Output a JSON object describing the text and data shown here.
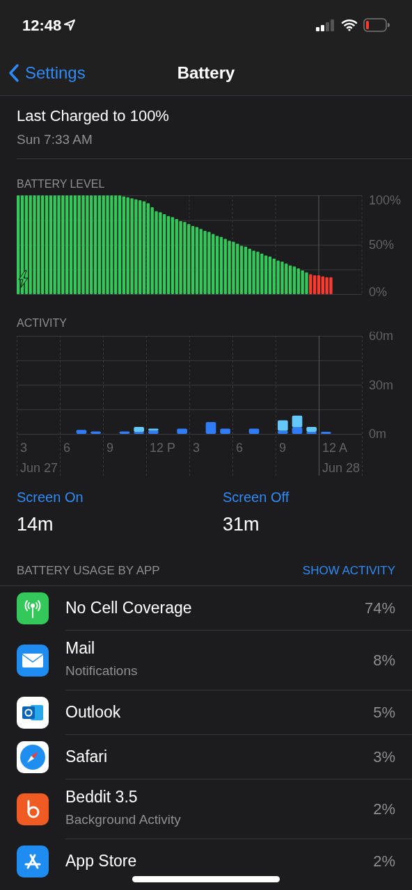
{
  "status_bar": {
    "time": "12:48"
  },
  "nav": {
    "back": "Settings",
    "title": "Battery"
  },
  "last_charged": {
    "title": "Last Charged to 100%",
    "time": "Sun 7:33 AM"
  },
  "battery_level": {
    "header": "BATTERY LEVEL",
    "chart_data": {
      "type": "bar",
      "stacked": true,
      "ylim": [
        0,
        100
      ],
      "yticks": [
        {
          "value": 0,
          "label": "0%"
        },
        {
          "value": 50,
          "label": "50%"
        },
        {
          "value": 100,
          "label": "100%"
        }
      ],
      "series": [
        {
          "color": "#34c759",
          "values": [
            100,
            100,
            100,
            100,
            100,
            100,
            100,
            100,
            100,
            100,
            100,
            100,
            100,
            100,
            100,
            100,
            100,
            100,
            100,
            100,
            100,
            100,
            100,
            100,
            100,
            100,
            99,
            98,
            97,
            96,
            95,
            94,
            92,
            88,
            84,
            83,
            81,
            79,
            78,
            76,
            74,
            73,
            71,
            69,
            68,
            66,
            64,
            63,
            61,
            59,
            58,
            56,
            54,
            53,
            51,
            49,
            48,
            46,
            44,
            43,
            41,
            39,
            38,
            36,
            34,
            33,
            31,
            29,
            28,
            26,
            24,
            22,
            null,
            null,
            null,
            null,
            null,
            null
          ]
        },
        {
          "color": "#ff3b30",
          "values": [
            null,
            null,
            null,
            null,
            null,
            null,
            null,
            null,
            null,
            null,
            null,
            null,
            null,
            null,
            null,
            null,
            null,
            null,
            null,
            null,
            null,
            null,
            null,
            null,
            null,
            null,
            null,
            null,
            null,
            null,
            null,
            null,
            null,
            null,
            null,
            null,
            null,
            null,
            null,
            null,
            null,
            null,
            null,
            null,
            null,
            null,
            null,
            null,
            null,
            null,
            null,
            null,
            null,
            null,
            null,
            null,
            null,
            null,
            null,
            null,
            null,
            null,
            null,
            null,
            null,
            null,
            null,
            null,
            null,
            null,
            null,
            null,
            20,
            19,
            19,
            18,
            17,
            17
          ]
        }
      ]
    }
  },
  "activity": {
    "header": "ACTIVITY",
    "chart_data": {
      "type": "bar",
      "stacked": true,
      "categories": [
        "3",
        null,
        null,
        "6",
        null,
        null,
        "9",
        null,
        null,
        "12 P",
        null,
        null,
        "3",
        null,
        null,
        "6",
        null,
        null,
        "9",
        null,
        null,
        "12 A",
        null,
        null
      ],
      "ylim": [
        0,
        60
      ],
      "yticks": [
        {
          "value": 0,
          "label": "0m"
        },
        {
          "value": 30,
          "label": "30m"
        },
        {
          "value": 60,
          "label": "60m"
        }
      ],
      "series": [
        {
          "color": "#2f7cf6",
          "values": [
            0,
            0,
            0,
            0,
            2.4,
            1.5,
            0,
            1.5,
            1.2,
            2,
            0,
            3.2,
            0,
            7.2,
            3.2,
            0,
            3.2,
            0,
            1.9,
            4,
            1.3,
            1.3,
            0,
            0
          ]
        },
        {
          "color": "#64c8fa",
          "values": [
            0,
            0,
            0,
            0,
            0,
            0,
            0,
            0,
            3.1,
            1.2,
            0,
            0,
            0,
            0,
            0,
            0,
            0,
            0,
            6.4,
            7.2,
            3,
            0,
            0,
            0
          ]
        }
      ]
    },
    "dates": [
      "Jun 27",
      "Jun 28"
    ]
  },
  "totals": [
    {
      "label": "Screen On",
      "value": "14m"
    },
    {
      "label": "Screen Off",
      "value": "31m"
    }
  ],
  "usage": {
    "header": "BATTERY USAGE BY APP",
    "action": "SHOW ACTIVITY",
    "apps": [
      {
        "kind": "antenna",
        "name": "No Cell Coverage",
        "percent": "74%"
      },
      {
        "kind": "mail",
        "name": "Mail",
        "detail": "Notifications",
        "percent": "8%"
      },
      {
        "kind": "outlook",
        "name": "Outlook",
        "percent": "5%"
      },
      {
        "kind": "safari",
        "name": "Safari",
        "percent": "3%"
      },
      {
        "kind": "beddit",
        "name": "Beddit 3.5",
        "detail": "Background Activity",
        "percent": "2%"
      },
      {
        "kind": "appstore",
        "name": "App Store",
        "percent": "2%"
      }
    ]
  }
}
